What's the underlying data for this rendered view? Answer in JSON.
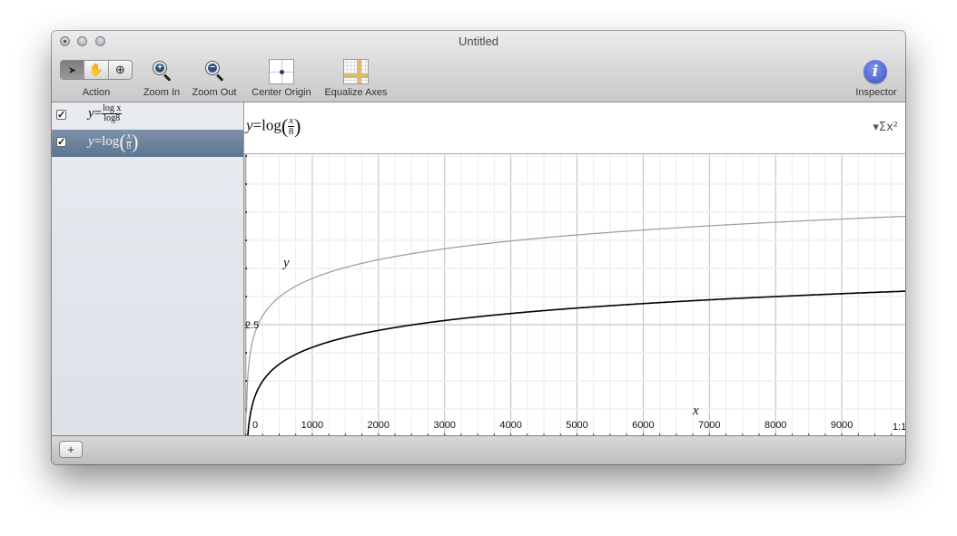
{
  "window": {
    "title": "Untitled"
  },
  "toolbar": {
    "action_label": "Action",
    "action_modes": [
      {
        "name": "pointer",
        "glyph": "➤",
        "active": true
      },
      {
        "name": "hand",
        "glyph": "✋",
        "active": false
      },
      {
        "name": "zoom",
        "glyph": "⊕",
        "active": false
      }
    ],
    "zoom_in_label": "Zoom In",
    "zoom_out_label": "Zoom Out",
    "center_origin_label": "Center Origin",
    "equalize_axes_label": "Equalize Axes",
    "inspector_label": "Inspector",
    "inspector_glyph": "i"
  },
  "sidebar": {
    "equations": [
      {
        "checked": true,
        "lhs": "y",
        "eq": "=",
        "num": "log x",
        "den": "log8",
        "selected": false,
        "color": "#888888"
      },
      {
        "checked": true,
        "lhs": "y",
        "eq": "=log",
        "num": "x",
        "den": "8",
        "selected": true,
        "color": "#000000"
      }
    ],
    "check_glyph": "✓"
  },
  "editor": {
    "lhs": "y",
    "eq": "=log",
    "num": "x",
    "den": "8",
    "lparen": "(",
    "rparen": ")",
    "sigma_button": "▾Σx²"
  },
  "bottombar": {
    "add_glyph": "+"
  },
  "chart_data": {
    "type": "line",
    "title": "",
    "xlabel": "x",
    "ylabel": "y",
    "xlim": [
      -20,
      10000
    ],
    "ylim": [
      0,
      5
    ],
    "x_major_step": 1000,
    "x_minor_step": 250,
    "y_step": 0.5,
    "x_tick_labels": [
      "0",
      "1000",
      "2000",
      "3000",
      "4000",
      "5000",
      "6000",
      "7000",
      "8000",
      "9000"
    ],
    "x_tick_values": [
      0,
      1000,
      2000,
      3000,
      4000,
      5000,
      6000,
      7000,
      8000,
      9000
    ],
    "y_tick_labels": [
      {
        "value": 2.5,
        "label": "2.5"
      }
    ],
    "corner_label": "1:1",
    "grid": true,
    "series": [
      {
        "name": "y=logx/log8",
        "function": "log8(x)",
        "color": "#999999",
        "sample_points": [
          [
            1,
            0
          ],
          [
            100,
            2.21
          ],
          [
            1000,
            3.32
          ],
          [
            5000,
            4.1
          ],
          [
            10000,
            4.43
          ]
        ]
      },
      {
        "name": "y=log(x/8)",
        "function": "log10(x/8)",
        "color": "#000000",
        "sample_points": [
          [
            8,
            0
          ],
          [
            100,
            1.1
          ],
          [
            1000,
            2.1
          ],
          [
            5000,
            2.8
          ],
          [
            10000,
            3.1
          ]
        ]
      }
    ]
  }
}
